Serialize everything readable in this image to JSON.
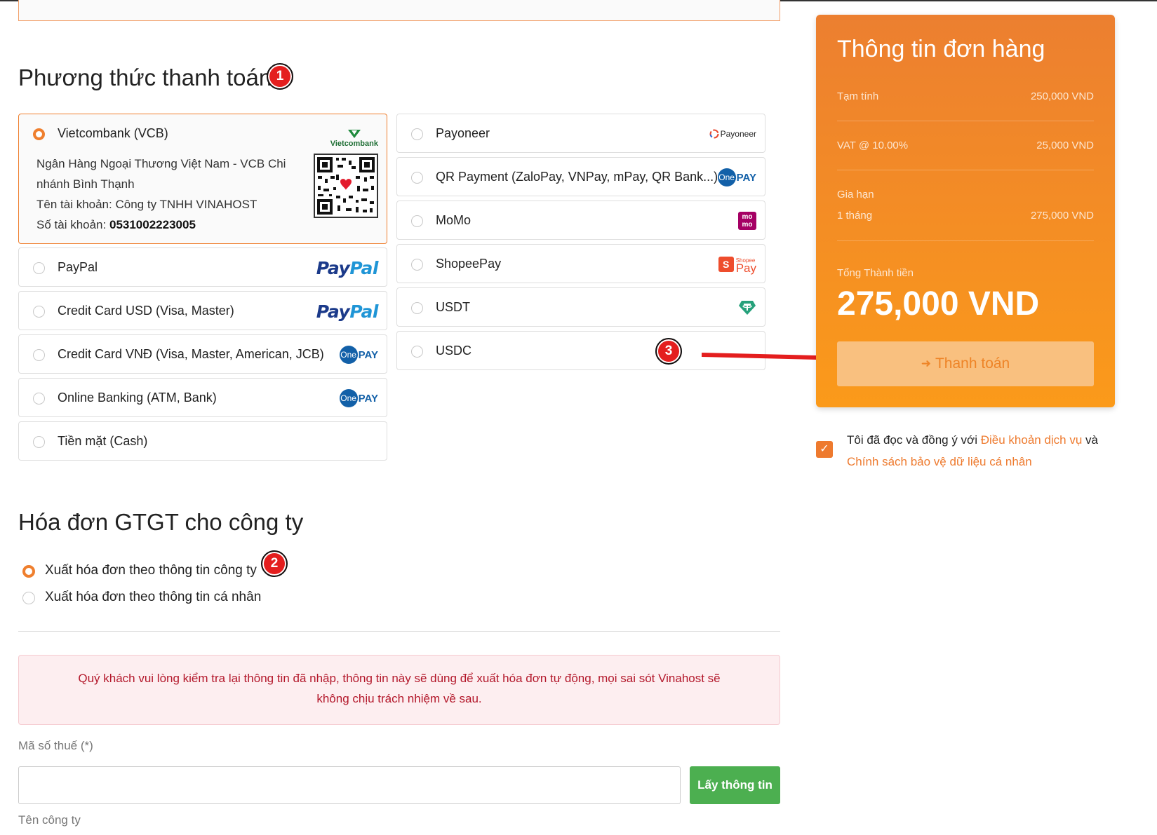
{
  "payment_section": {
    "title": "Phương thức thanh toán",
    "badge": "1"
  },
  "methods_left": [
    {
      "label": "Vietcombank (VCB)",
      "logo": "vietcombank-logo",
      "selected": true
    },
    {
      "label": "PayPal",
      "logo": "paypal-logo",
      "selected": false
    },
    {
      "label": "Credit Card USD (Visa, Master)",
      "logo": "paypal-logo",
      "selected": false
    },
    {
      "label": "Credit Card VNĐ (Visa, Master, American, JCB)",
      "logo": "onepay-logo",
      "selected": false
    },
    {
      "label": "Online Banking (ATM, Bank)",
      "logo": "onepay-logo",
      "selected": false
    },
    {
      "label": "Tiền mặt (Cash)",
      "logo": "",
      "selected": false
    }
  ],
  "vcb_details": {
    "bank_name": "Ngân Hàng Ngoại Thương Việt Nam - VCB Chi nhánh Bình Thạnh",
    "account_name_label": "Tên tài khoản:",
    "account_name": "Công ty TNHH VINAHOST",
    "account_number_label": "Số tài khoản:",
    "account_number": "0531002223005",
    "logo_text": "Vietcombank"
  },
  "methods_right": [
    {
      "label": "Payoneer",
      "logo": "payoneer-logo",
      "selected": false
    },
    {
      "label": "QR Payment (ZaloPay, VNPay, mPay, QR Bank...)",
      "logo": "onepay-logo",
      "selected": false
    },
    {
      "label": "MoMo",
      "logo": "momo-logo",
      "selected": false
    },
    {
      "label": "ShopeePay",
      "logo": "shopeepay-logo",
      "selected": false
    },
    {
      "label": "USDT",
      "logo": "tether-logo",
      "selected": false
    },
    {
      "label": "USDC",
      "logo": "",
      "selected": false
    }
  ],
  "logos": {
    "paypal_a": "Pay",
    "paypal_b": "Pal",
    "onepay_a": "One",
    "onepay_b": "PAY",
    "payoneer": "Payoneer",
    "momo_a": "mo",
    "momo_b": "mo",
    "shopee_small": "Shopee",
    "shopee_s": "S",
    "shopee_pay": "Pay"
  },
  "order_summary": {
    "title": "Thông tin đơn hàng",
    "subtotal_label": "Tạm tính",
    "subtotal_value": "250,000 VND",
    "vat_label": "VAT @ 10.00%",
    "vat_value": "25,000 VND",
    "renewal_label": "Gia hạn",
    "renewal_period": "1 tháng",
    "renewal_value": "275,000 VND",
    "total_label": "Tổng Thành tiền",
    "total_value": "275,000 VND",
    "pay_button": "Thanh toán",
    "badge": "3"
  },
  "terms": {
    "prefix": "Tôi đã đọc và đồng ý với",
    "link1": "Điều khoản dịch vụ",
    "and": "và",
    "link2": "Chính sách bảo vệ dữ liệu cá nhân",
    "checked": true
  },
  "invoice_section": {
    "title": "Hóa đơn GTGT cho công ty",
    "badge": "2",
    "option_company": "Xuất hóa đơn theo thông tin công ty",
    "option_personal": "Xuất hóa đơn theo thông tin cá nhân",
    "selected": "company"
  },
  "alert_text": "Quý khách vui lòng kiểm tra lại thông tin đã nhập, thông tin này sẽ dùng để xuất hóa đơn tự động, mọi sai sót Vinahost sẽ không chịu trách nhiệm về sau.",
  "form": {
    "tax_label": "Mã số thuế (*)",
    "tax_value": "",
    "fetch_button": "Lấy thông tin",
    "company_label": "Tên công ty"
  },
  "colors": {
    "accent": "#ef7f2e",
    "success": "#4caf50",
    "alert_text": "#b3172a",
    "badge": "#e41e1e"
  }
}
